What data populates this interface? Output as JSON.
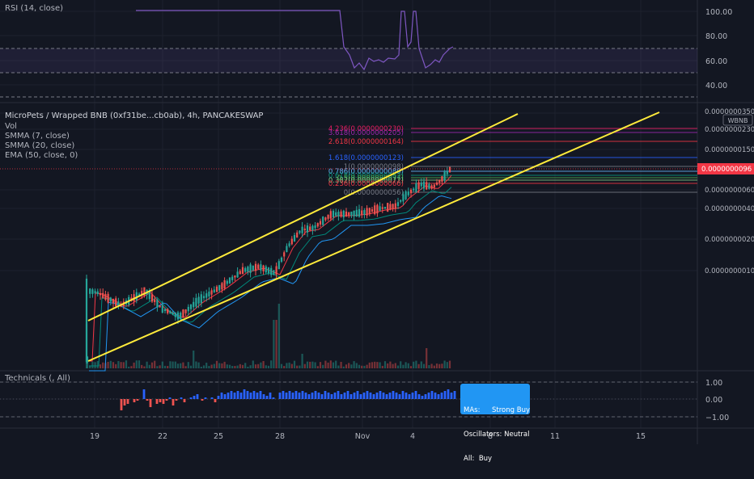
{
  "colors": {
    "background": "#131722",
    "up": "#26a69a",
    "down": "#ef5350",
    "rsi_line": "#7e57c2",
    "channel": "#ffeb3b",
    "smma7": "#f23645",
    "smma20": "#00897b",
    "ema50": "#2196f3",
    "price_marker": "#f23645",
    "tech_box": "#2196f3"
  },
  "rsi_pane": {
    "label": "RSI (14, close)",
    "axis_ticks": [
      "100.00",
      "80.00",
      "60.00",
      "40.00"
    ]
  },
  "main_pane": {
    "title": "MicroPets / Wrapped BNB (0xf31be...cb0ab), 4h, PANCAKESWAP",
    "indicators": [
      "Vol",
      "SMMA (7, close)",
      "SMMA (20, close)",
      "EMA (50, close, 0)"
    ],
    "quote_badge": "WBNB",
    "current_price": "0.0000000096",
    "price_ticks": [
      "0.0000000350",
      "0.0000000230",
      "0.0000000150",
      "0.0000000060",
      "0.0000000040",
      "0.0000000020",
      "0.0000000010"
    ],
    "fib_levels": [
      {
        "label": "4.236(0.0000000230)",
        "color": "#e91e63"
      },
      {
        "label": "3.618(0.0000000205)",
        "color": "#9c27b0"
      },
      {
        "label": "2.618(0.0000000164)",
        "color": "#f23645"
      },
      {
        "label": "1.618(0.0000000123)",
        "color": "#2962ff"
      },
      {
        "label": "1(0.0000000098)",
        "color": "#787b86"
      },
      {
        "label": "0.786(0.0000000089)",
        "color": "#64b5f6"
      },
      {
        "label": "0.618(0.0000000082)",
        "color": "#089981"
      },
      {
        "label": "0.5(0.0000000077)",
        "color": "#4caf50"
      },
      {
        "label": "0.382(0.0000000072)",
        "color": "#81c784"
      },
      {
        "label": "0.236(0.0000000066)",
        "color": "#f23645"
      },
      {
        "label": "0(0.0000000056)",
        "color": "#787b86"
      }
    ]
  },
  "technicals_pane": {
    "label": "Technicals (, All)",
    "axis_ticks": [
      "1.00",
      "0.00",
      "−1.00"
    ],
    "summary": {
      "mas_key": "MAs:",
      "mas_value": "Strong Buy",
      "osc_key": "Oscillators:",
      "osc_value": "Neutral",
      "all_key": "All:",
      "all_value": "Buy"
    }
  },
  "time_axis": [
    "19",
    "22",
    "25",
    "28",
    "Nov",
    "4",
    "8",
    "11",
    "15"
  ]
}
